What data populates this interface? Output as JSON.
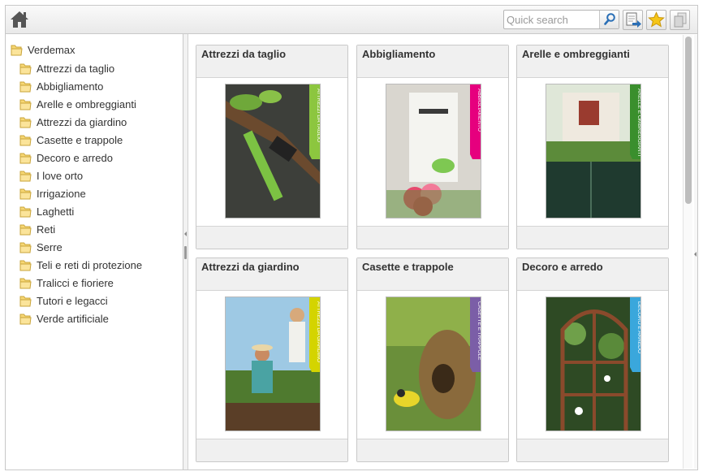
{
  "toolbar": {
    "home_icon": "home-icon",
    "search": {
      "placeholder": "Quick search",
      "value": ""
    },
    "search_icon": "magnifier-icon",
    "buttons": [
      {
        "name": "export-button",
        "icon": "document-arrow-icon"
      },
      {
        "name": "favorites-button",
        "icon": "star-icon"
      },
      {
        "name": "disabled-tool-button",
        "icon": "document-stack-icon"
      }
    ]
  },
  "tree": {
    "root": {
      "label": "Verdemax"
    },
    "items": [
      {
        "label": "Attrezzi da taglio"
      },
      {
        "label": "Abbigliamento"
      },
      {
        "label": "Arelle e ombreggianti"
      },
      {
        "label": "Attrezzi da giardino"
      },
      {
        "label": "Casette e trappole"
      },
      {
        "label": "Decoro e arredo"
      },
      {
        "label": "I love orto"
      },
      {
        "label": "Irrigazione"
      },
      {
        "label": "Laghetti"
      },
      {
        "label": "Reti"
      },
      {
        "label": "Serre"
      },
      {
        "label": "Teli e reti di protezione"
      },
      {
        "label": "Tralicci e fioriere"
      },
      {
        "label": "Tutori e legacci"
      },
      {
        "label": "Verde artificiale"
      }
    ]
  },
  "cards": [
    {
      "title": "Attrezzi da taglio",
      "cover_label": "ATTREZZI DA TAGLIO",
      "accent": "#8cc63f"
    },
    {
      "title": "Abbigliamento",
      "cover_label": "ABBIGLIAMENTO",
      "accent": "#e6007e"
    },
    {
      "title": "Arelle e ombreggianti",
      "cover_label": "ARELLE E OMBREGGIANTI",
      "accent": "#3a8f2d"
    },
    {
      "title": "Attrezzi da giardino",
      "cover_label": "ATTREZZI DA GIARDINO",
      "accent": "#d4d400"
    },
    {
      "title": "Casette e trappole",
      "cover_label": "CASETTE E TRAPPOLE",
      "accent": "#7b5ea7"
    },
    {
      "title": "Decoro e arredo",
      "cover_label": "DECORO E ARREDO",
      "accent": "#3aa7dc"
    }
  ],
  "colors": {
    "toolbar_bg": "#ececec",
    "folder_fill": "#f7d774",
    "panel_border": "#c9c9c9",
    "card_header_bg": "#f0f0f0",
    "icon_blue": "#2a6fb6",
    "star_yellow": "#f5c518"
  }
}
